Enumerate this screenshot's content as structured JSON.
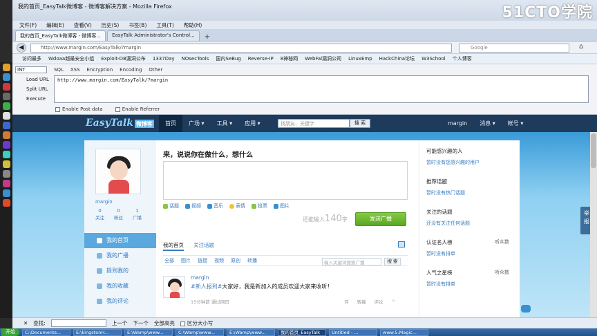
{
  "window": {
    "title": "我的首页_EasyTalk微博客 - 微博客解决方案 - Mozilla Firefox",
    "watermark": "51CTO学院"
  },
  "menu": [
    "文件(F)",
    "编辑(E)",
    "查看(V)",
    "历史(S)",
    "书签(B)",
    "工具(T)",
    "帮助(H)"
  ],
  "tabs": [
    {
      "label": "我的首页_EasyTalk微博客 - 微博客...",
      "active": true
    },
    {
      "label": "EasyTalk Administrator's Control...",
      "active": false
    }
  ],
  "nav": {
    "url": "http://www.margin.com/EasyTalk/?margin",
    "search_placeholder": "Google"
  },
  "bookmarks": [
    "访问最多",
    "Wdoaa越最安全小组",
    "Exploit-DB漏洞公布",
    "1337Day",
    "NOsecTools",
    "国内SeBug",
    "Reverse-IP",
    "8神秘网",
    "WebFal漏洞公司",
    "LinuxEmp",
    "HackChina论坛",
    "W3School",
    "个人博客"
  ],
  "hackbar": {
    "encoding_select": "INT",
    "toolbar": [
      "SQL",
      "XSS",
      "Encryption",
      "Encoding",
      "Other"
    ],
    "actions": [
      "Load URL",
      "Split URL",
      "Execute"
    ],
    "url_text": "http://www.margin.com/EasyTalk/?margin",
    "post_data_label": "Enable Post data",
    "referrer_label": "Enable Referrer"
  },
  "site": {
    "logo": "EasyTalk",
    "logo_cn": "微博客",
    "nav": [
      "首页",
      "广场 ▾",
      "工具 ▾",
      "应用 ▾"
    ],
    "search_placeholder": "找朋友、关键字",
    "search_button": "搜 索",
    "user": "margin",
    "messages": "消息 ▾",
    "account": "帐号 ▾"
  },
  "profile": {
    "name": "margin",
    "stats": [
      {
        "n": "0",
        "l": "关注"
      },
      {
        "n": "0",
        "l": "粉丝"
      },
      {
        "n": "1",
        "l": "广播"
      }
    ],
    "nav": [
      {
        "label": "我的首页",
        "active": true
      },
      {
        "label": "我的广播",
        "active": false
      },
      {
        "label": "提到我的",
        "active": false
      },
      {
        "label": "我的收藏",
        "active": false
      },
      {
        "label": "我的评论",
        "active": false
      }
    ]
  },
  "compose": {
    "prompt": "来，说说你在做什么，想什么",
    "tools": [
      "话题",
      "视频",
      "音乐",
      "表情",
      "投票",
      "图片"
    ],
    "counter_prefix": "还能输入",
    "counter_value": "140",
    "counter_suffix": "字",
    "submit": "发送广播"
  },
  "feed": {
    "tabs": [
      {
        "label": "我的首页",
        "active": true
      },
      {
        "label": "关注话题",
        "active": false
      }
    ],
    "filters": [
      "全部",
      "图片",
      "链接",
      "视频",
      "原创",
      "转播"
    ],
    "search_placeholder": "输入关键词搜索广播",
    "search_button": "搜 索",
    "post": {
      "name": "margin",
      "tag": "#新人报到#",
      "text": "大家好，我是新加入的成员欢迎大家来收听！",
      "meta": "15分钟前 通过网页",
      "actions": [
        "评",
        "转播",
        "评论"
      ]
    }
  },
  "sidebar": [
    {
      "title": "可能感兴趣的人",
      "right": "",
      "body": "暂时没有您感兴趣的用户"
    },
    {
      "title": "推荐话题",
      "right": "",
      "body": "暂时没有热门话题"
    },
    {
      "title": "关注的话题",
      "right": "",
      "body": "还没有关注任何话题"
    },
    {
      "title": "认证名人榜",
      "right": "听众数",
      "body": "暂时没有排单"
    },
    {
      "title": "人气之星榜",
      "right": "听众数",
      "body": "暂时没有排单"
    }
  ],
  "side_tab": "举 报",
  "findbar": {
    "label": "查找:",
    "prev": "上一个",
    "next": "下一个",
    "highlight": "全部高亮",
    "case": "区分大小写"
  },
  "taskbar": {
    "start": "开始",
    "items": [
      "C:\\Documents...",
      "E:\\kingstonH...",
      "E:\\Wamp\\www...",
      "C:\\Wamp\\www...",
      "E:\\Wamp\\www...",
      "我的首页_EasyTalk",
      "Untitled - ...",
      "www.5.Magic..."
    ]
  }
}
